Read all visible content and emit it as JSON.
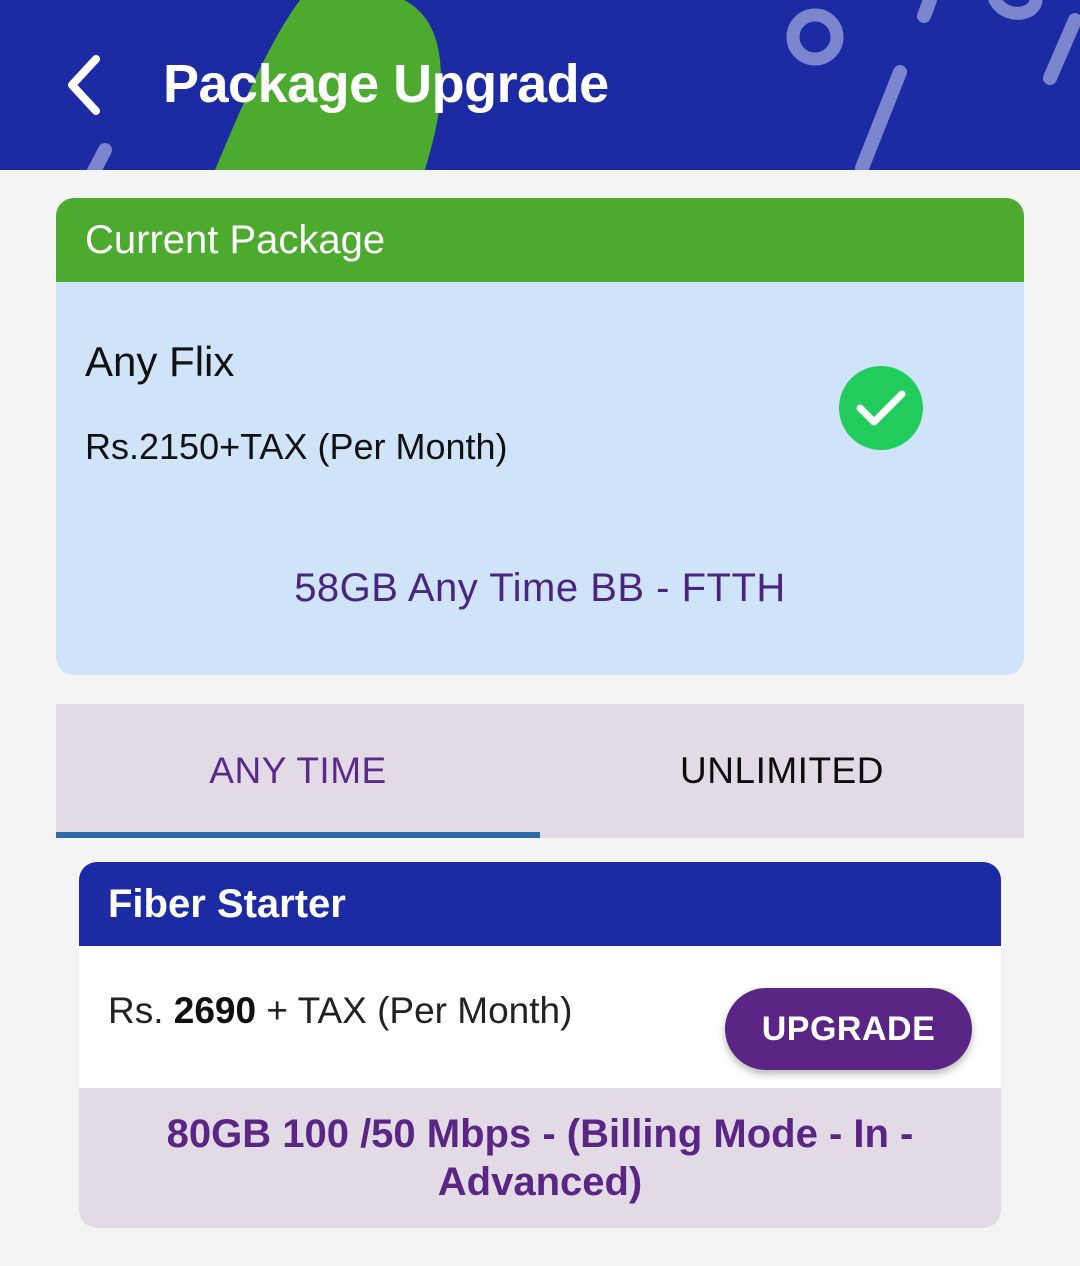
{
  "header": {
    "title": "Package Upgrade",
    "back_icon": "chevron-left-icon",
    "background_color": "#1c2aa3"
  },
  "current_package": {
    "heading": "Current Package",
    "name": "Any Flix",
    "price": "Rs.2150+TAX (Per Month)",
    "description": "58GB Any Time BB - FTTH",
    "status_icon": "check-circle-icon",
    "heading_color": "#4cab2e",
    "card_color": "#cfe3f9"
  },
  "tabs": [
    {
      "label": "ANY TIME",
      "active": true
    },
    {
      "label": "UNLIMITED",
      "active": false
    }
  ],
  "plans": [
    {
      "name": "Fiber Starter",
      "price_prefix": "Rs.",
      "price_amount": "2690",
      "price_suffix": "+ TAX (Per Month)",
      "button_label": "UPGRADE",
      "description": "80GB 100 /50 Mbps - (Billing Mode - In -Advanced)"
    }
  ],
  "colors": {
    "accent_purple": "#5a2585",
    "tab_indicator": "#2a6aa8",
    "page_background": "#f4f4f4"
  }
}
